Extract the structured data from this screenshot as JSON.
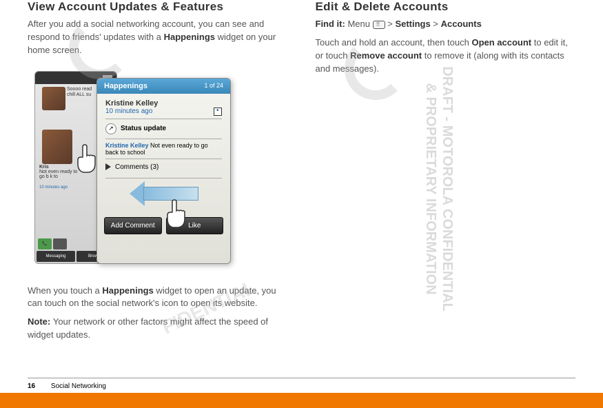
{
  "left": {
    "heading": "View Account Updates & Features",
    "intro_before": "After you add a social networking account, you can see and respond to friends' updates with a ",
    "intro_bold": "Happenings",
    "intro_after": " widget on your home screen.",
    "phone_bg": {
      "line1": "Soooo read",
      "line2": "chill ALL su",
      "card_name": "Kris",
      "card_line1": "Not even ready to",
      "card_line2": "go b k to ",
      "card_time": "10 minutes ago",
      "btn_messaging": "Messaging",
      "btn_browser": "Browser"
    },
    "popup": {
      "title": "Happenings",
      "counter": "1 of 24",
      "name": "Kristine Kelley",
      "time": "10 minutes ago",
      "status_label": "Status update",
      "status_name": "Kristine Kelley",
      "status_text": "Not even ready to go back to school",
      "comments": "Comments (3)",
      "add_comment": "Add Comment",
      "like": "Like"
    },
    "para2_before": "When you touch a ",
    "para2_bold": "Happenings",
    "para2_after": " widget to open an update, you can touch on the social network's icon to open its website.",
    "note_label": "Note: ",
    "note_text": "Your network or other factors might affect the speed of widget updates."
  },
  "right": {
    "heading": "Edit & Delete Accounts",
    "findit_label": "Find it: ",
    "findit_menu": "Menu",
    "gt": ">",
    "findit_settings": "Settings",
    "findit_accounts": "Accounts",
    "para_before": "Touch and hold an account, then touch ",
    "para_bold1": "Open account",
    "para_mid": " to edit it, or touch ",
    "para_bold2": "Remove account",
    "para_after": " to remove it (along with its contacts and messages)."
  },
  "watermark": {
    "line1": "DRAFT - MOTOROLA CONFIDENTIAL",
    "line2": "& PROPRIETARY INFORMATION",
    "center": "FIDENTIAL"
  },
  "footer": {
    "page": "16",
    "section": "Social Networking"
  }
}
